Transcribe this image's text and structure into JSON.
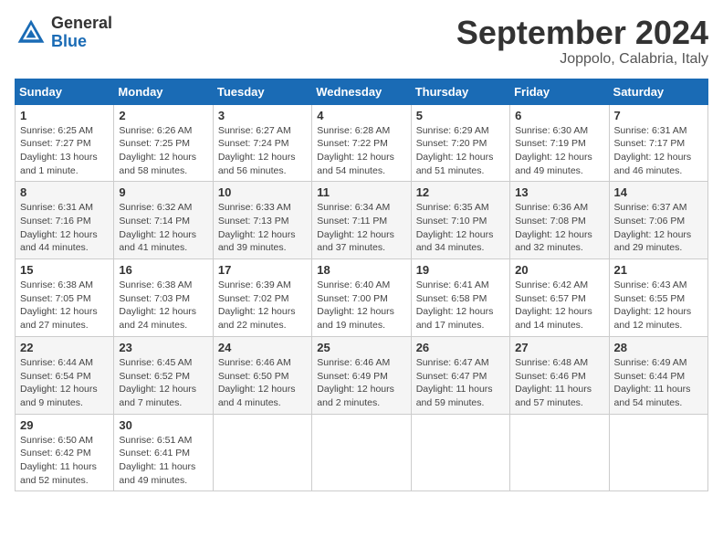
{
  "header": {
    "logo_general": "General",
    "logo_blue": "Blue",
    "month_title": "September 2024",
    "subtitle": "Joppolo, Calabria, Italy"
  },
  "weekdays": [
    "Sunday",
    "Monday",
    "Tuesday",
    "Wednesday",
    "Thursday",
    "Friday",
    "Saturday"
  ],
  "weeks": [
    [
      {
        "day": "1",
        "sunrise": "Sunrise: 6:25 AM",
        "sunset": "Sunset: 7:27 PM",
        "daylight": "Daylight: 13 hours and 1 minute."
      },
      {
        "day": "2",
        "sunrise": "Sunrise: 6:26 AM",
        "sunset": "Sunset: 7:25 PM",
        "daylight": "Daylight: 12 hours and 58 minutes."
      },
      {
        "day": "3",
        "sunrise": "Sunrise: 6:27 AM",
        "sunset": "Sunset: 7:24 PM",
        "daylight": "Daylight: 12 hours and 56 minutes."
      },
      {
        "day": "4",
        "sunrise": "Sunrise: 6:28 AM",
        "sunset": "Sunset: 7:22 PM",
        "daylight": "Daylight: 12 hours and 54 minutes."
      },
      {
        "day": "5",
        "sunrise": "Sunrise: 6:29 AM",
        "sunset": "Sunset: 7:20 PM",
        "daylight": "Daylight: 12 hours and 51 minutes."
      },
      {
        "day": "6",
        "sunrise": "Sunrise: 6:30 AM",
        "sunset": "Sunset: 7:19 PM",
        "daylight": "Daylight: 12 hours and 49 minutes."
      },
      {
        "day": "7",
        "sunrise": "Sunrise: 6:31 AM",
        "sunset": "Sunset: 7:17 PM",
        "daylight": "Daylight: 12 hours and 46 minutes."
      }
    ],
    [
      {
        "day": "8",
        "sunrise": "Sunrise: 6:31 AM",
        "sunset": "Sunset: 7:16 PM",
        "daylight": "Daylight: 12 hours and 44 minutes."
      },
      {
        "day": "9",
        "sunrise": "Sunrise: 6:32 AM",
        "sunset": "Sunset: 7:14 PM",
        "daylight": "Daylight: 12 hours and 41 minutes."
      },
      {
        "day": "10",
        "sunrise": "Sunrise: 6:33 AM",
        "sunset": "Sunset: 7:13 PM",
        "daylight": "Daylight: 12 hours and 39 minutes."
      },
      {
        "day": "11",
        "sunrise": "Sunrise: 6:34 AM",
        "sunset": "Sunset: 7:11 PM",
        "daylight": "Daylight: 12 hours and 37 minutes."
      },
      {
        "day": "12",
        "sunrise": "Sunrise: 6:35 AM",
        "sunset": "Sunset: 7:10 PM",
        "daylight": "Daylight: 12 hours and 34 minutes."
      },
      {
        "day": "13",
        "sunrise": "Sunrise: 6:36 AM",
        "sunset": "Sunset: 7:08 PM",
        "daylight": "Daylight: 12 hours and 32 minutes."
      },
      {
        "day": "14",
        "sunrise": "Sunrise: 6:37 AM",
        "sunset": "Sunset: 7:06 PM",
        "daylight": "Daylight: 12 hours and 29 minutes."
      }
    ],
    [
      {
        "day": "15",
        "sunrise": "Sunrise: 6:38 AM",
        "sunset": "Sunset: 7:05 PM",
        "daylight": "Daylight: 12 hours and 27 minutes."
      },
      {
        "day": "16",
        "sunrise": "Sunrise: 6:38 AM",
        "sunset": "Sunset: 7:03 PM",
        "daylight": "Daylight: 12 hours and 24 minutes."
      },
      {
        "day": "17",
        "sunrise": "Sunrise: 6:39 AM",
        "sunset": "Sunset: 7:02 PM",
        "daylight": "Daylight: 12 hours and 22 minutes."
      },
      {
        "day": "18",
        "sunrise": "Sunrise: 6:40 AM",
        "sunset": "Sunset: 7:00 PM",
        "daylight": "Daylight: 12 hours and 19 minutes."
      },
      {
        "day": "19",
        "sunrise": "Sunrise: 6:41 AM",
        "sunset": "Sunset: 6:58 PM",
        "daylight": "Daylight: 12 hours and 17 minutes."
      },
      {
        "day": "20",
        "sunrise": "Sunrise: 6:42 AM",
        "sunset": "Sunset: 6:57 PM",
        "daylight": "Daylight: 12 hours and 14 minutes."
      },
      {
        "day": "21",
        "sunrise": "Sunrise: 6:43 AM",
        "sunset": "Sunset: 6:55 PM",
        "daylight": "Daylight: 12 hours and 12 minutes."
      }
    ],
    [
      {
        "day": "22",
        "sunrise": "Sunrise: 6:44 AM",
        "sunset": "Sunset: 6:54 PM",
        "daylight": "Daylight: 12 hours and 9 minutes."
      },
      {
        "day": "23",
        "sunrise": "Sunrise: 6:45 AM",
        "sunset": "Sunset: 6:52 PM",
        "daylight": "Daylight: 12 hours and 7 minutes."
      },
      {
        "day": "24",
        "sunrise": "Sunrise: 6:46 AM",
        "sunset": "Sunset: 6:50 PM",
        "daylight": "Daylight: 12 hours and 4 minutes."
      },
      {
        "day": "25",
        "sunrise": "Sunrise: 6:46 AM",
        "sunset": "Sunset: 6:49 PM",
        "daylight": "Daylight: 12 hours and 2 minutes."
      },
      {
        "day": "26",
        "sunrise": "Sunrise: 6:47 AM",
        "sunset": "Sunset: 6:47 PM",
        "daylight": "Daylight: 11 hours and 59 minutes."
      },
      {
        "day": "27",
        "sunrise": "Sunrise: 6:48 AM",
        "sunset": "Sunset: 6:46 PM",
        "daylight": "Daylight: 11 hours and 57 minutes."
      },
      {
        "day": "28",
        "sunrise": "Sunrise: 6:49 AM",
        "sunset": "Sunset: 6:44 PM",
        "daylight": "Daylight: 11 hours and 54 minutes."
      }
    ],
    [
      {
        "day": "29",
        "sunrise": "Sunrise: 6:50 AM",
        "sunset": "Sunset: 6:42 PM",
        "daylight": "Daylight: 11 hours and 52 minutes."
      },
      {
        "day": "30",
        "sunrise": "Sunrise: 6:51 AM",
        "sunset": "Sunset: 6:41 PM",
        "daylight": "Daylight: 11 hours and 49 minutes."
      },
      null,
      null,
      null,
      null,
      null
    ]
  ]
}
